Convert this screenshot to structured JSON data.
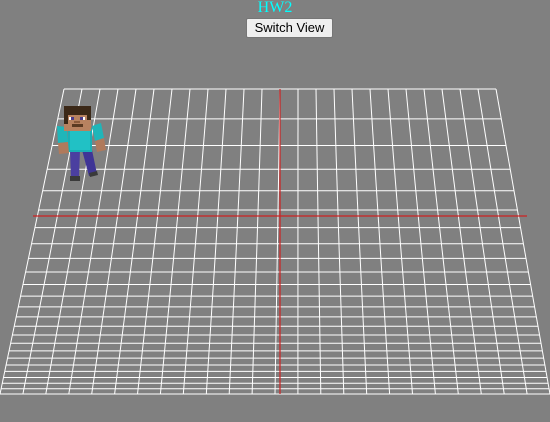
{
  "header": {
    "title": "HW2",
    "switch_view_label": "Switch View"
  },
  "scene": {
    "background_color": "#808080",
    "grid_color": "#ffffff",
    "axis_color": "#cc2222",
    "title_color": "#00ffff",
    "character": "minecraft-steve"
  }
}
